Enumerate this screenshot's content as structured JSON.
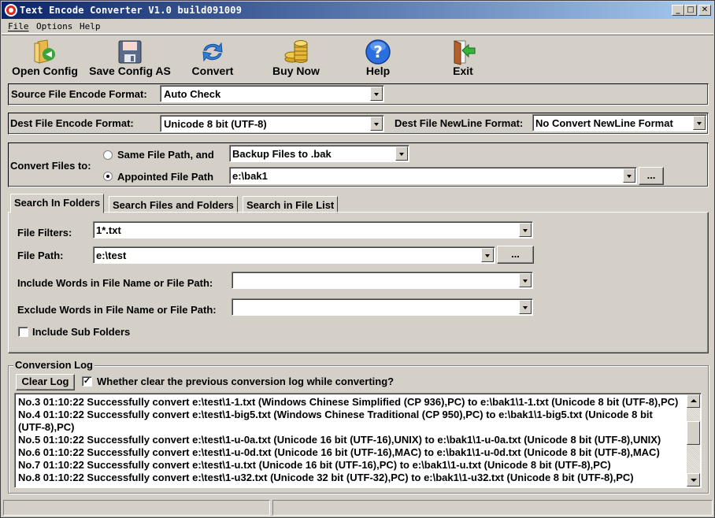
{
  "window": {
    "title": "Text Encode Converter V1.0 build091009",
    "controls": {
      "minimize": "_",
      "maximize": "□",
      "close": "✕"
    }
  },
  "menu": [
    {
      "label": "File",
      "accel": "F"
    },
    {
      "label": "Options"
    },
    {
      "label": "Help"
    }
  ],
  "toolbar": [
    {
      "label": "Open Config",
      "icon": "folder-open-icon"
    },
    {
      "label": "Save Config AS",
      "icon": "floppy-disk-icon"
    },
    {
      "label": "Convert",
      "icon": "refresh-arrows-icon"
    },
    {
      "label": "Buy Now",
      "icon": "gold-coins-icon"
    },
    {
      "label": "Help",
      "icon": "question-icon"
    },
    {
      "label": "Exit",
      "icon": "exit-door-icon"
    }
  ],
  "source_format": {
    "label": "Source File Encode Format:",
    "value": "Auto Check"
  },
  "dest_format": {
    "label": "Dest File Encode Format:",
    "value": "Unicode 8 bit (UTF-8)"
  },
  "newline_format": {
    "label": "Dest File NewLine Format:",
    "value": "No Convert NewLine Format"
  },
  "convert_to": {
    "label": "Convert Files to:",
    "same_path": {
      "label": "Same File Path, and",
      "selected": false,
      "value": "Backup Files to .bak"
    },
    "appointed_path": {
      "label": "Appointed File Path",
      "selected": true,
      "value": "e:\\bak1"
    },
    "browse_label": "..."
  },
  "tabs": [
    {
      "label": "Search In Folders",
      "active": true
    },
    {
      "label": "Search Files and Folders",
      "active": false
    },
    {
      "label": "Search in File List",
      "active": false
    }
  ],
  "search": {
    "file_filters": {
      "label": "File Filters:",
      "value": "1*.txt"
    },
    "file_path": {
      "label": "File Path:",
      "value": "e:\\test",
      "browse_label": "..."
    },
    "include_words": {
      "label": "Include Words in File Name or File Path:",
      "value": ""
    },
    "exclude_words": {
      "label": "Exclude Words in File Name or File Path:",
      "value": ""
    },
    "include_sub_folders": {
      "label": "Include Sub Folders",
      "checked": false
    }
  },
  "log": {
    "title": "Conversion Log",
    "clear_label": "Clear Log",
    "clear_previous": {
      "label": "Whether clear the previous conversion log while converting?",
      "checked": true,
      "mark": "✓"
    },
    "lines": [
      "No.3 01:10:22 Successfully convert e:\\test\\1-1.txt (Windows Chinese Simplified (CP 936),PC) to e:\\bak1\\1-1.txt (Unicode 8 bit (UTF-8),PC)",
      "No.4 01:10:22 Successfully convert e:\\test\\1-big5.txt (Windows Chinese Traditional (CP 950),PC) to e:\\bak1\\1-big5.txt (Unicode 8 bit",
      "(UTF-8),PC)",
      "No.5 01:10:22 Successfully convert e:\\test\\1-u-0a.txt (Unicode 16 bit (UTF-16),UNIX) to e:\\bak1\\1-u-0a.txt (Unicode 8 bit (UTF-8),UNIX)",
      "No.6 01:10:22 Successfully convert e:\\test\\1-u-0d.txt (Unicode 16 bit (UTF-16),MAC) to e:\\bak1\\1-u-0d.txt (Unicode 8 bit (UTF-8),MAC)",
      "No.7 01:10:22 Successfully convert e:\\test\\1-u.txt (Unicode 16 bit (UTF-16),PC) to e:\\bak1\\1-u.txt (Unicode 8 bit (UTF-8),PC)",
      "No.8 01:10:22 Successfully convert e:\\test\\1-u32.txt (Unicode 32 bit (UTF-32),PC) to e:\\bak1\\1-u32.txt (Unicode 8 bit (UTF-8),PC)"
    ]
  },
  "statusbar": [
    "",
    ""
  ]
}
